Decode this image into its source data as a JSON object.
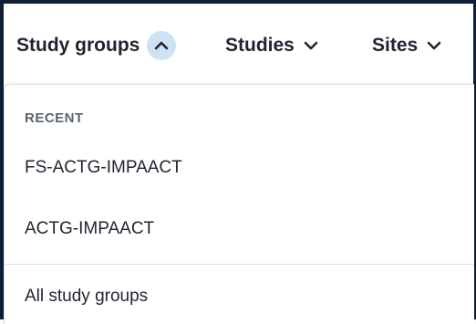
{
  "nav": {
    "items": [
      {
        "label": "Study groups",
        "icon": "chevron-up-icon",
        "active": true
      },
      {
        "label": "Studies",
        "icon": "chevron-down-icon",
        "active": false
      },
      {
        "label": "Sites",
        "icon": "chevron-down-icon",
        "active": false
      }
    ]
  },
  "dropdown": {
    "section_label": "RECENT",
    "recent_items": [
      {
        "label": "FS-ACTG-IMPAACT"
      },
      {
        "label": "ACTG-IMPAACT"
      }
    ],
    "all_label": "All study groups"
  },
  "colors": {
    "frame": "#0f1d36",
    "active_chevron_bg": "#cfe1f5",
    "text": "#1f2530",
    "muted_text": "#5b6470",
    "divider": "#dde1e6"
  }
}
